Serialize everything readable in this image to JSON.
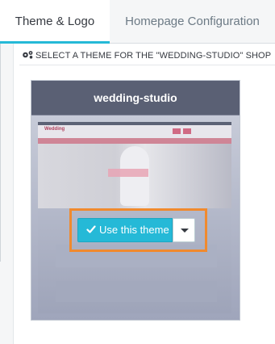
{
  "tabs": [
    {
      "label": "Theme & Logo",
      "active": true
    },
    {
      "label": "Homepage Configuration",
      "active": false
    }
  ],
  "section": {
    "heading": "SELECT A THEME FOR THE \"WEDDING-STUDIO\" SHOP",
    "heading_icon": "gears-icon"
  },
  "theme_card": {
    "name": "wedding-studio",
    "preview_logo": "Wedding",
    "actions": {
      "use_label": "Use this theme",
      "use_icon": "check-icon",
      "dropdown_icon": "caret-down-icon"
    }
  },
  "colors": {
    "accent": "#25b9d7",
    "highlight": "#f08a2e",
    "card_header": "#5a6074"
  }
}
